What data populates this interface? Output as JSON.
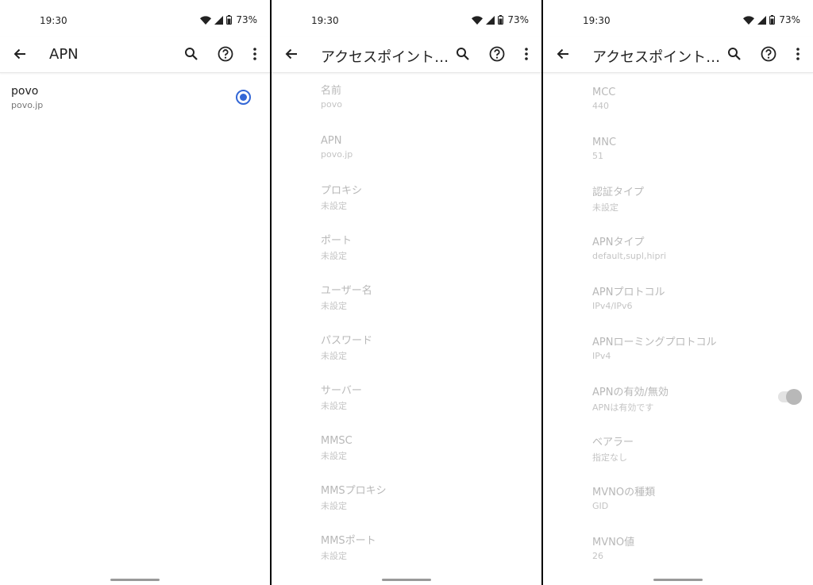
{
  "status_bar": {
    "time": "19:30",
    "battery": "73%"
  },
  "screen1": {
    "title": "APN",
    "apns": [
      {
        "name": "povo",
        "apn": "povo.jp"
      }
    ]
  },
  "screen2": {
    "title": "アクセスポイント…",
    "fields": [
      {
        "label": "名前",
        "value": "povo"
      },
      {
        "label": "APN",
        "value": "povo.jp"
      },
      {
        "label": "プロキシ",
        "value": "未設定"
      },
      {
        "label": "ポート",
        "value": "未設定"
      },
      {
        "label": "ユーザー名",
        "value": "未設定"
      },
      {
        "label": "パスワード",
        "value": "未設定"
      },
      {
        "label": "サーバー",
        "value": "未設定"
      },
      {
        "label": "MMSC",
        "value": "未設定"
      },
      {
        "label": "MMSプロキシ",
        "value": "未設定"
      },
      {
        "label": "MMSポート",
        "value": "未設定"
      }
    ]
  },
  "screen3": {
    "title": "アクセスポイント…",
    "fields": [
      {
        "label": "MCC",
        "value": "440"
      },
      {
        "label": "MNC",
        "value": "51"
      },
      {
        "label": "認証タイプ",
        "value": "未設定"
      },
      {
        "label": "APNタイプ",
        "value": "default,supl,hipri"
      },
      {
        "label": "APNプロトコル",
        "value": "IPv4/IPv6"
      },
      {
        "label": "APNローミングプロトコル",
        "value": "IPv4"
      },
      {
        "label": "APNの有効/無効",
        "value": "APNは有効です",
        "toggle_on": true
      },
      {
        "label": "ベアラー",
        "value": "指定なし"
      },
      {
        "label": "MVNOの種類",
        "value": "GID"
      },
      {
        "label": "MVNO値",
        "value": "26"
      }
    ]
  },
  "icons": {
    "back": "arrow-back-icon",
    "search": "search-icon",
    "help": "help-circle-icon",
    "more": "more-vert-icon",
    "wifi": "wifi-icon",
    "signal": "signal-icon",
    "battery": "battery-icon"
  },
  "colors": {
    "accent": "#3367d6",
    "disabled_text": "#b8b8b8"
  }
}
